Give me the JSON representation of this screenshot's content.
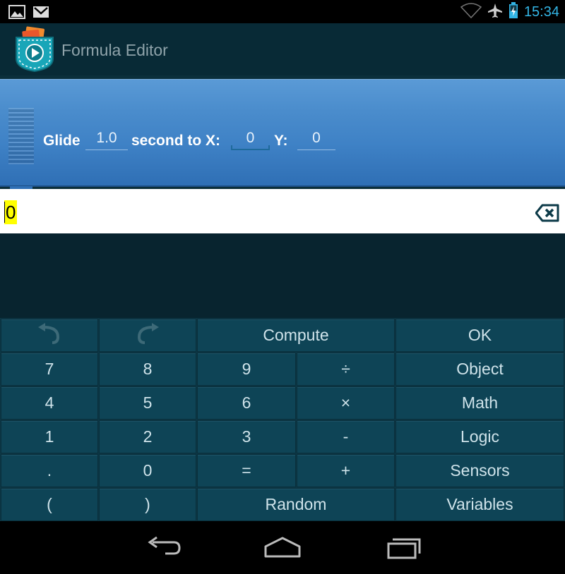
{
  "status_bar": {
    "time": "15:34",
    "left_icons": [
      "image-icon",
      "gmail-icon"
    ],
    "right_icons": [
      "wifi-icon",
      "airplane-icon",
      "battery-icon"
    ]
  },
  "action_bar": {
    "title": "Formula Editor",
    "logo_icon": "pocket-code-logo"
  },
  "brick": {
    "color": "#4a8ccc",
    "label_glide": "Glide",
    "duration_value": "1.0",
    "label_second_to_x": "second to X:",
    "x_value": "0",
    "label_y": "Y:",
    "y_value": "0"
  },
  "formula": {
    "text": "0",
    "highlight_color": "#ffff00",
    "backspace_icon": "backspace-icon"
  },
  "keypad": {
    "undo_icon": "undo-icon",
    "redo_icon": "redo-icon",
    "compute": "Compute",
    "ok": "OK",
    "k7": "7",
    "k8": "8",
    "k9": "9",
    "divide": "÷",
    "object": "Object",
    "k4": "4",
    "k5": "5",
    "k6": "6",
    "multiply": "×",
    "math": "Math",
    "k1": "1",
    "k2": "2",
    "k3": "3",
    "minus": "-",
    "logic": "Logic",
    "dot": ".",
    "k0": "0",
    "equals": "=",
    "plus": "+",
    "sensors": "Sensors",
    "lparen": "(",
    "rparen": ")",
    "random": "Random",
    "variables": "Variables"
  },
  "nav_bar": {
    "icons": [
      "back-icon",
      "home-icon",
      "recents-icon"
    ]
  }
}
